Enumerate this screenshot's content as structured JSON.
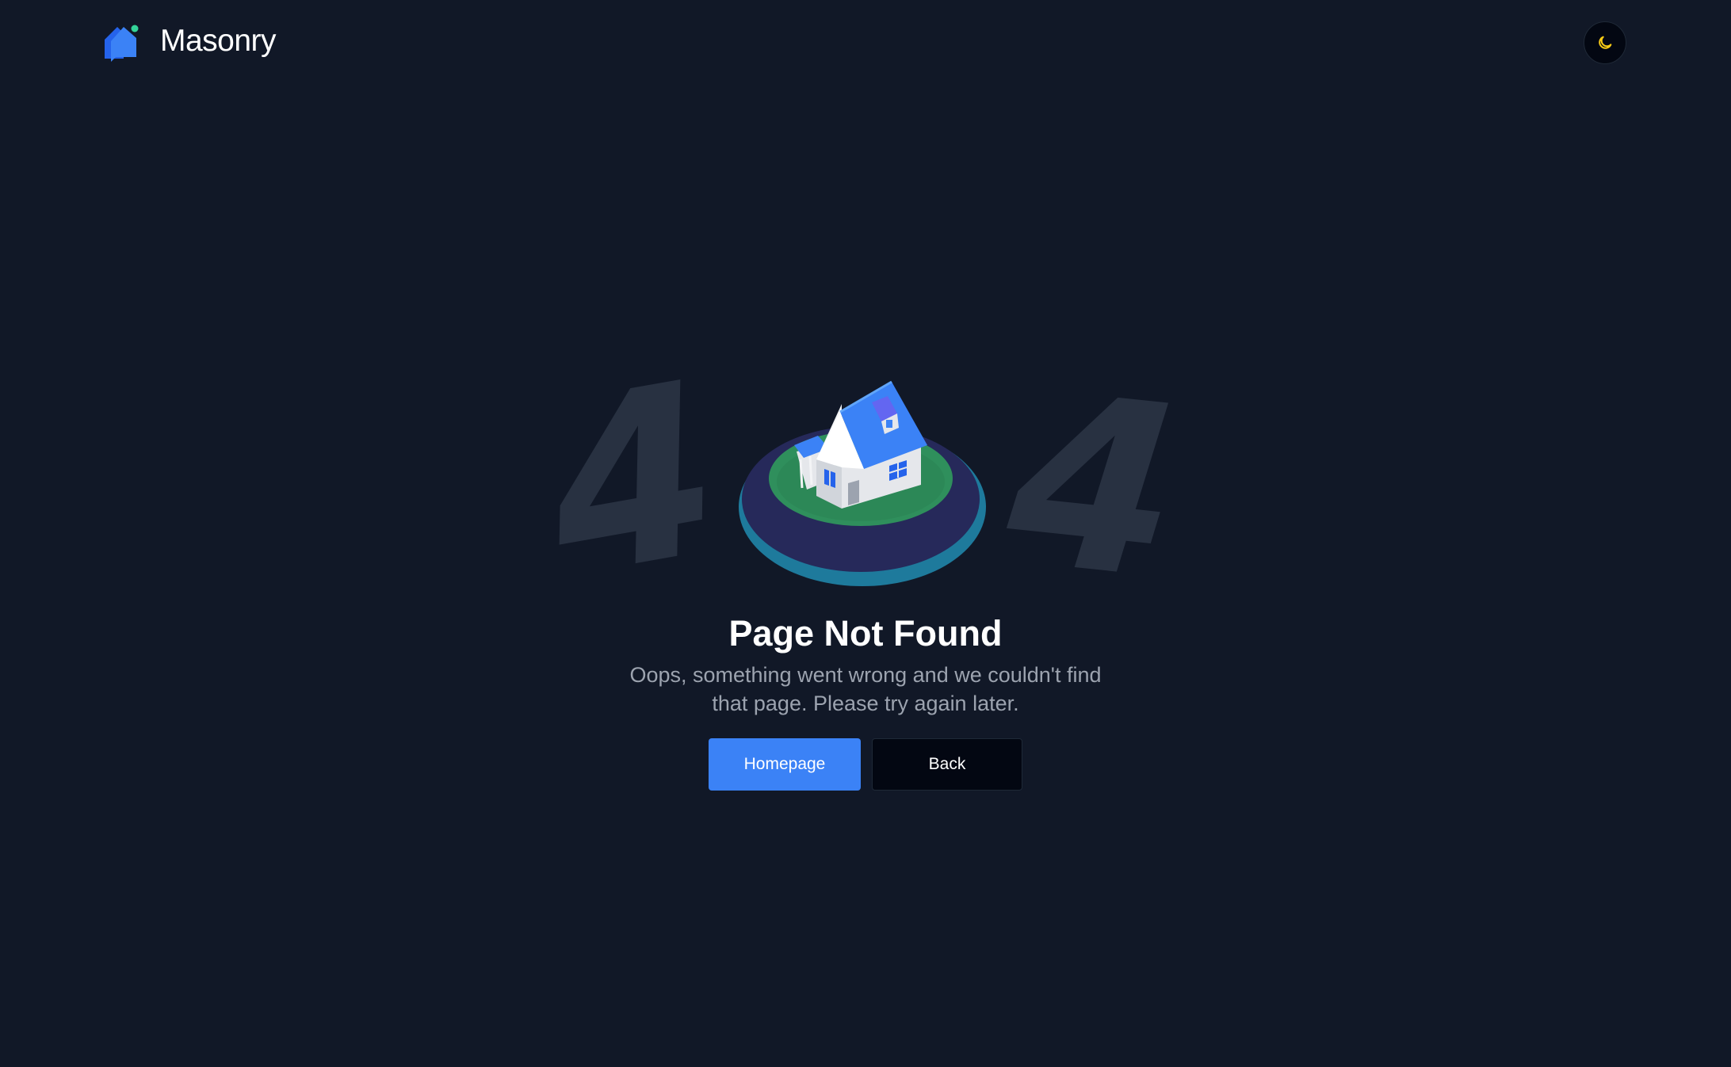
{
  "header": {
    "brand_name": "Masonry",
    "brand_logo_icon": "house-logo-icon",
    "theme_toggle_icon": "moon-icon"
  },
  "illustration": {
    "left_digit": "4",
    "right_digit": "4",
    "center_icon": "house-on-island-illustration"
  },
  "main": {
    "title": "Page Not Found",
    "subtitle": "Oops, something went wrong and we couldn't find that page. Please try again later.",
    "primary_button_label": "Homepage",
    "secondary_button_label": "Back"
  },
  "colors": {
    "background": "#111827",
    "primary": "#3b82f6",
    "button_dark": "#030712",
    "muted_text": "#9ca3af",
    "moon": "#facc15"
  }
}
